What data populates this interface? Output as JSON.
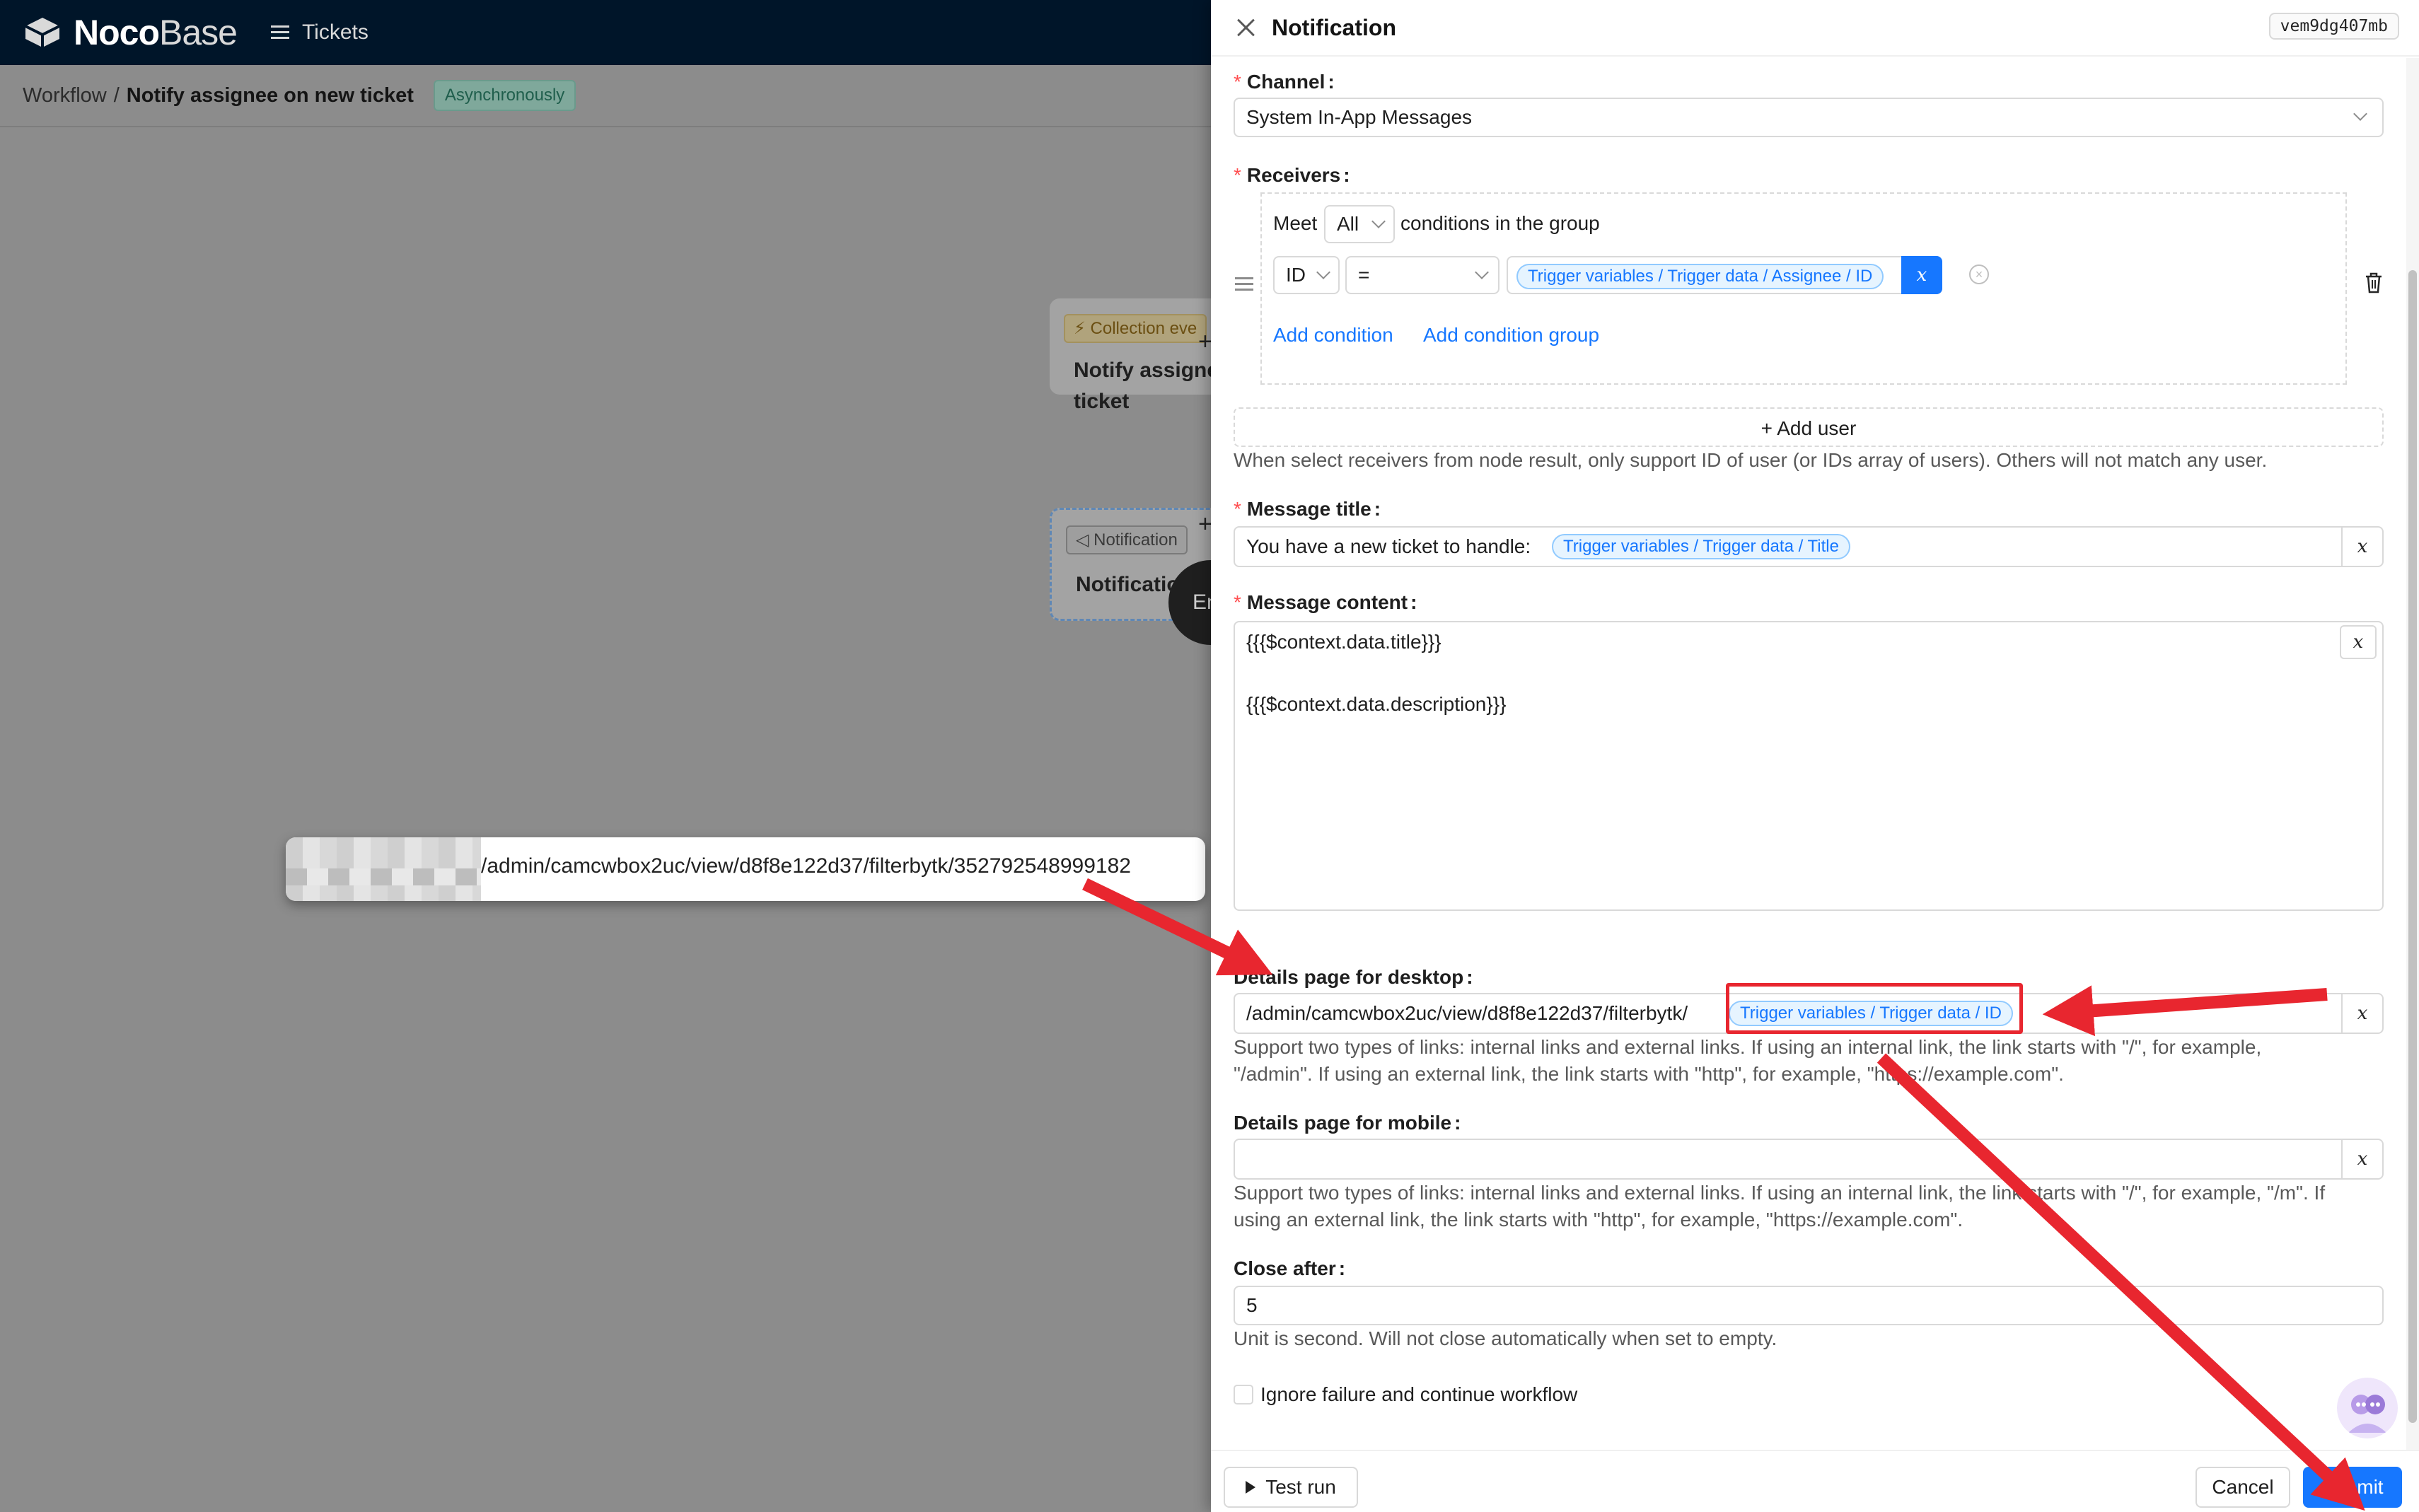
{
  "app": {
    "logo_bold": "Noco",
    "logo_light": "Base",
    "menu_label": "Tickets"
  },
  "breadcrumb": {
    "root": "Workflow",
    "separator": "/",
    "current": "Notify assignee on new ticket",
    "mode_tag": "Asynchronously"
  },
  "canvas": {
    "trigger_node": {
      "tag": "Collection eve",
      "title_line1": "Notify assigne",
      "title_line2": "ticket"
    },
    "notify_node": {
      "tag": "Notification",
      "title": "Notification"
    },
    "end_node_label": "En",
    "plus_glyph": "+",
    "url_popup": "/admin/camcwbox2uc/view/d8f8e122d37/filterbytk/352792548999182"
  },
  "drawer": {
    "title": "Notification",
    "node_key": "vem9dg407mb",
    "channel": {
      "label": "Channel",
      "value": "System In-App Messages"
    },
    "receivers": {
      "label": "Receivers",
      "meet": "Meet",
      "logic": "All",
      "group_text": "conditions in the group",
      "field": "ID",
      "operator": "=",
      "value_tag": "Trigger variables / Trigger data / Assignee / ID",
      "add_condition": "Add condition",
      "add_group": "Add condition group",
      "add_user": "Add user",
      "help": "When select receivers from node result, only support ID of user (or IDs array of users). Others will not match any user."
    },
    "message_title": {
      "label": "Message title",
      "prefix": "You have a new ticket to handle:",
      "tag": "Trigger variables / Trigger data / Title"
    },
    "message_content": {
      "label": "Message content",
      "line1": "{{{$context.data.title}}}",
      "line2": "{{{$context.data.description}}}"
    },
    "desktop_url": {
      "label": "Details page for desktop",
      "prefix": "/admin/camcwbox2uc/view/d8f8e122d37/filterbytk/",
      "tag": "Trigger variables / Trigger data / ID",
      "help_line1": "Support two types of links: internal links and external links. If using an internal link, the link starts with \"/\", for example,",
      "help_line2": "\"/admin\". If using an external link, the link starts with \"http\", for example, \"https://example.com\"."
    },
    "mobile_url": {
      "label": "Details page for mobile",
      "value": "",
      "help_line1": "Support two types of links: internal links and external links. If using an internal link, the link starts with \"/\", for example, \"/m\". If",
      "help_line2": "using an external link, the link starts with \"http\", for example, \"https://example.com\"."
    },
    "close_after": {
      "label": "Close after",
      "value": "5",
      "help": "Unit is second. Will not close automatically when set to empty."
    },
    "ignore_failure_label": "Ignore failure and continue workflow",
    "var_button": "x",
    "footer": {
      "test_run": "Test run",
      "cancel": "Cancel",
      "submit": "Submit"
    }
  },
  "colors": {
    "primary": "#1677ff",
    "annotation_red": "#e8262f",
    "header_dark": "#001529",
    "required_star": "#ff4d4f"
  }
}
